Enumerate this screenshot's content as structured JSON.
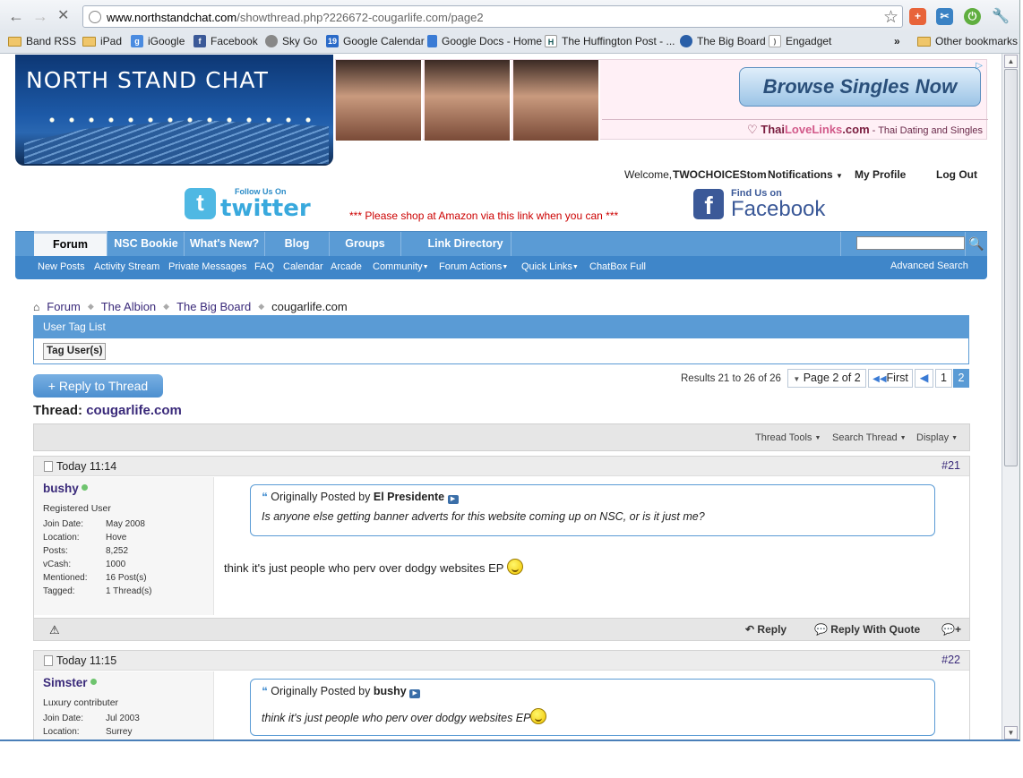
{
  "browser": {
    "url_host": "www.northstandchat.com",
    "url_path": "/showthread.php?226672-cougarlife.com/page2",
    "bookmarks": [
      "Band RSS",
      "iPad",
      "iGoogle",
      "Facebook",
      "Sky Go",
      "Google Calendar",
      "Google Docs - Home",
      "The Huffington Post - ...",
      "The Big Board",
      "Engadget"
    ],
    "other_bookmarks": "Other bookmarks",
    "more": "»"
  },
  "site": {
    "logo_text": "NORTH STAND CHAT",
    "ad_button": "Browse Singles Now",
    "ad_brand_a": "Thai",
    "ad_brand_b": "LoveLinks",
    "ad_brand_c": ".com",
    "ad_tagline": " - Thai Dating and Singles",
    "welcome": "Welcome,",
    "username": "TWOCHOICEStom",
    "notifications": "Notifications",
    "my_profile": "My Profile",
    "logout": "Log Out",
    "twitter_follow": "Follow Us On",
    "twitter_word": "twitter",
    "amazon_note": "*** Please shop at Amazon via this link when you can ***",
    "fb_find": "Find Us on",
    "fb_word": "Facebook"
  },
  "nav": {
    "tabs": [
      "Forum",
      "NSC Bookie",
      "What's New?",
      "Blog",
      "Groups",
      "Link Directory"
    ],
    "sub": [
      "New Posts",
      "Activity Stream",
      "Private Messages",
      "FAQ",
      "Calendar",
      "Arcade",
      "Community",
      "Forum Actions",
      "Quick Links",
      "ChatBox Full"
    ],
    "advanced_search": "Advanced Search"
  },
  "breadcrumb": [
    "Forum",
    "The Albion",
    "The Big Board",
    "cougarlife.com"
  ],
  "taglist": {
    "header": "User Tag List",
    "button": "Tag User(s)"
  },
  "thread": {
    "reply_button": "+ Reply to Thread",
    "results": "Results 21 to 26 of 26",
    "page_label": "Page 2 of 2",
    "first": "First",
    "pages": [
      "1",
      "2"
    ],
    "title_prefix": "Thread:",
    "title": "cougarlife.com",
    "tools": [
      "Thread Tools",
      "Search Thread",
      "Display"
    ]
  },
  "posts": [
    {
      "time": "Today 11:14",
      "number": "#21",
      "user": "bushy",
      "user_title": "Registered User",
      "stats": [
        [
          "Join Date:",
          "May 2008"
        ],
        [
          "Location:",
          "Hove"
        ],
        [
          "Posts:",
          "8,252"
        ],
        [
          "vCash:",
          "1000"
        ],
        [
          "Mentioned:",
          "16 Post(s)"
        ],
        [
          "Tagged:",
          "1 Thread(s)"
        ]
      ],
      "quote_prefix": "Originally Posted by",
      "quote_author": "El Presidente",
      "quote_text": "Is anyone else getting banner adverts for this website coming up on NSC, or is it just me?",
      "body": "think it's just people who perv over dodgy websites EP",
      "reply": "Reply",
      "reply_quote": "Reply With Quote"
    },
    {
      "time": "Today 11:15",
      "number": "#22",
      "user": "Simster",
      "user_title": "Luxury contributer",
      "stats": [
        [
          "Join Date:",
          "Jul 2003"
        ],
        [
          "Location:",
          "Surrey"
        ]
      ],
      "quote_prefix": "Originally Posted by",
      "quote_author": "bushy",
      "quote_text": "think it's just people who perv over dodgy websites EP"
    }
  ]
}
